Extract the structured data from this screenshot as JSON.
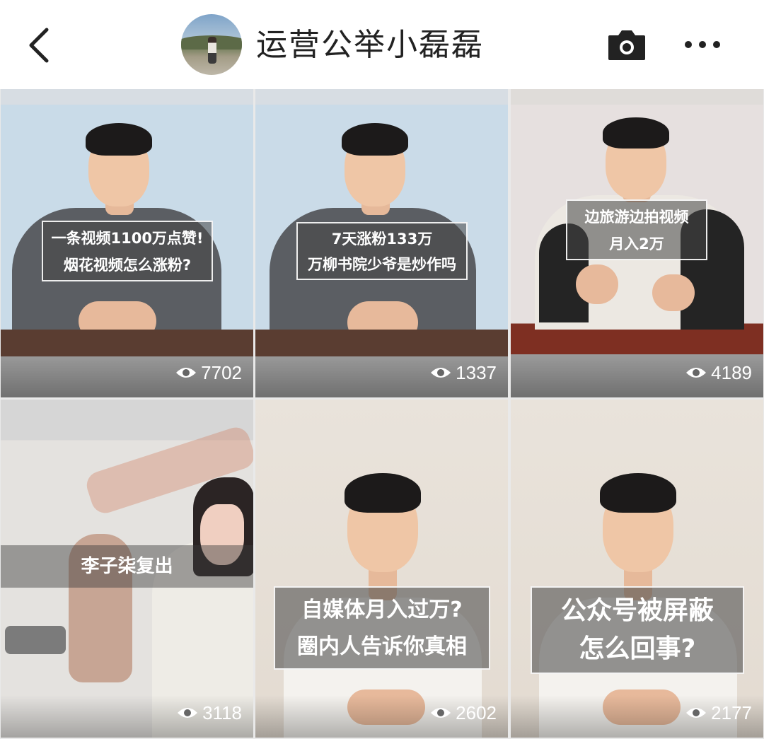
{
  "header": {
    "back_icon": "chevron-left-icon",
    "title": "运营公举小磊磊",
    "camera_icon": "camera-icon",
    "more_icon": "more-dots-icon"
  },
  "videos": [
    {
      "caption_line1": "一条视频1100万点赞!",
      "caption_line2": "烟花视频怎么涨粉?",
      "views": "7702"
    },
    {
      "caption_line1": "7天涨粉133万",
      "caption_line2": "万柳书院少爷是炒作吗",
      "views": "1337"
    },
    {
      "caption_line1": "边旅游边拍视频",
      "caption_line2": "月入2万",
      "views": "4189"
    },
    {
      "caption_line1": "李子柒复出",
      "caption_line2": "",
      "views": "3118"
    },
    {
      "caption_line1": "自媒体月入过万?",
      "caption_line2": "圈内人告诉你真相",
      "views": "2602"
    },
    {
      "caption_line1": "公众号被屏蔽",
      "caption_line2": "怎么回事?",
      "views": "2177"
    }
  ],
  "colors": {
    "caption_bg": "#464646",
    "stat_text": "#ffffff"
  }
}
